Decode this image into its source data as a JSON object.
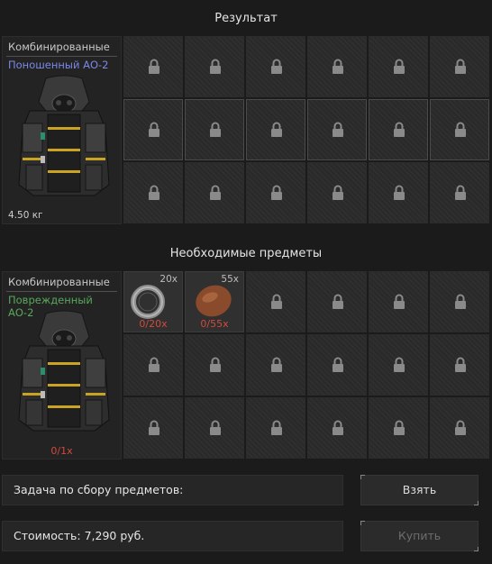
{
  "result": {
    "title": "Результат",
    "item": {
      "category": "Комбинированные",
      "name": "Поношенный АО-2",
      "name_color": "#7b88e6",
      "weight": "4.50 кг",
      "icon": "armor-suit-icon"
    }
  },
  "required": {
    "title": "Необходимые предметы",
    "item": {
      "category": "Комбинированные",
      "name": "Поврежденный АО-2",
      "name_color": "#58a85a",
      "count": "0/1х",
      "icon": "armor-suit-icon"
    },
    "materials": [
      {
        "icon": "ring-icon",
        "qty": "20х",
        "have": "0/20х"
      },
      {
        "icon": "leather-hide-icon",
        "qty": "55х",
        "have": "0/55х"
      }
    ]
  },
  "task": {
    "label": "Задача по сбору предметов:"
  },
  "cost": {
    "label": "Стоимость: 7,290 руб."
  },
  "buttons": {
    "take": "Взять",
    "buy": "Купить"
  },
  "colors": {
    "background": "#1b1b1b",
    "count_red": "#d24a3a"
  }
}
